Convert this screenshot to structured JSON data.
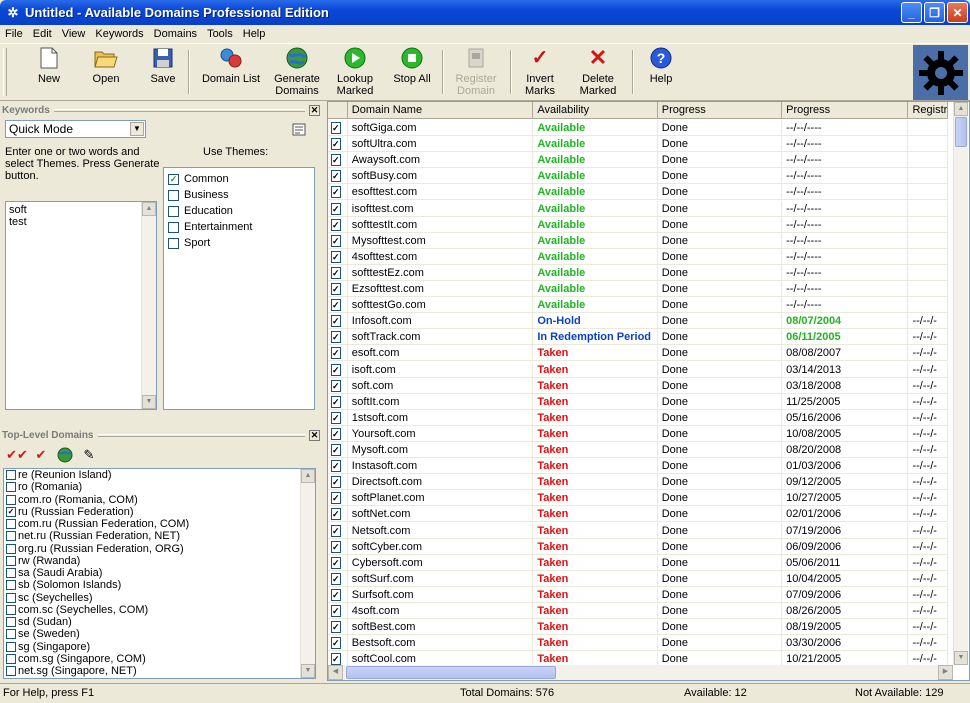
{
  "window": {
    "title": "Untitled - Available Domains Professional Edition"
  },
  "menu": [
    "File",
    "Edit",
    "View",
    "Keywords",
    "Domains",
    "Tools",
    "Help"
  ],
  "toolbar": {
    "new": "New",
    "open": "Open",
    "save": "Save",
    "domain_list": "Domain List",
    "generate_l1": "Generate",
    "generate_l2": "Domains",
    "lookup_l1": "Lookup",
    "lookup_l2": "Marked",
    "stop_all": "Stop All",
    "register_l1": "Register",
    "register_l2": "Domain",
    "invert_l1": "Invert",
    "invert_l2": "Marks",
    "delete_l1": "Delete",
    "delete_l2": "Marked",
    "help": "Help"
  },
  "keywords": {
    "title": "Keywords",
    "mode": "Quick Mode",
    "description": "Enter one or two words and select Themes. Press Generate button.",
    "use_themes": "Use Themes:",
    "words": [
      "soft",
      "test"
    ]
  },
  "themes": [
    {
      "label": "Common",
      "checked": true
    },
    {
      "label": "Business",
      "checked": false
    },
    {
      "label": "Education",
      "checked": false
    },
    {
      "label": "Entertainment",
      "checked": false
    },
    {
      "label": "Sport",
      "checked": false
    }
  ],
  "tld": {
    "title": "Top-Level Domains",
    "items": [
      {
        "label": "re (Reunion Island)",
        "checked": false
      },
      {
        "label": "ro (Romania)",
        "checked": false
      },
      {
        "label": "com.ro (Romania, COM)",
        "checked": false
      },
      {
        "label": "ru (Russian Federation)",
        "checked": true
      },
      {
        "label": "com.ru (Russian Federation, COM)",
        "checked": false
      },
      {
        "label": "net.ru (Russian Federation, NET)",
        "checked": false
      },
      {
        "label": "org.ru (Russian Federation, ORG)",
        "checked": false
      },
      {
        "label": "rw (Rwanda)",
        "checked": false
      },
      {
        "label": "sa (Saudi Arabia)",
        "checked": false
      },
      {
        "label": "sb (Solomon Islands)",
        "checked": false
      },
      {
        "label": "sc (Seychelles)",
        "checked": false
      },
      {
        "label": "com.sc (Seychelles, COM)",
        "checked": false
      },
      {
        "label": "sd (Sudan)",
        "checked": false
      },
      {
        "label": "se (Sweden)",
        "checked": false
      },
      {
        "label": "sg (Singapore)",
        "checked": false
      },
      {
        "label": "com.sg (Singapore, COM)",
        "checked": false
      },
      {
        "label": "net.sg (Singapore, NET)",
        "checked": false
      }
    ]
  },
  "grid": {
    "headers": [
      "Domain Name",
      "Availability",
      "Progress",
      "Progress",
      "Registr"
    ],
    "rows": [
      [
        "softGiga.com",
        "Available",
        "Done",
        "--/--/----",
        ""
      ],
      [
        "softUltra.com",
        "Available",
        "Done",
        "--/--/----",
        ""
      ],
      [
        "Awaysoft.com",
        "Available",
        "Done",
        "--/--/----",
        ""
      ],
      [
        "softBusy.com",
        "Available",
        "Done",
        "--/--/----",
        ""
      ],
      [
        "esofttest.com",
        "Available",
        "Done",
        "--/--/----",
        ""
      ],
      [
        "isofttest.com",
        "Available",
        "Done",
        "--/--/----",
        ""
      ],
      [
        "softtestIt.com",
        "Available",
        "Done",
        "--/--/----",
        ""
      ],
      [
        "Mysofttest.com",
        "Available",
        "Done",
        "--/--/----",
        ""
      ],
      [
        "4softtest.com",
        "Available",
        "Done",
        "--/--/----",
        ""
      ],
      [
        "softtestEz.com",
        "Available",
        "Done",
        "--/--/----",
        ""
      ],
      [
        "Ezsofttest.com",
        "Available",
        "Done",
        "--/--/----",
        ""
      ],
      [
        "softtestGo.com",
        "Available",
        "Done",
        "--/--/----",
        ""
      ],
      [
        "Infosoft.com",
        "On-Hold",
        "Done",
        "08/07/2004",
        "--/--/-"
      ],
      [
        "softTrack.com",
        "In Redemption Period",
        "Done",
        "06/11/2005",
        "--/--/-"
      ],
      [
        "esoft.com",
        "Taken",
        "Done",
        "08/08/2007",
        "--/--/-"
      ],
      [
        "isoft.com",
        "Taken",
        "Done",
        "03/14/2013",
        "--/--/-"
      ],
      [
        "soft.com",
        "Taken",
        "Done",
        "03/18/2008",
        "--/--/-"
      ],
      [
        "softIt.com",
        "Taken",
        "Done",
        "11/25/2005",
        "--/--/-"
      ],
      [
        "1stsoft.com",
        "Taken",
        "Done",
        "05/16/2006",
        "--/--/-"
      ],
      [
        "Yoursoft.com",
        "Taken",
        "Done",
        "10/08/2005",
        "--/--/-"
      ],
      [
        "Mysoft.com",
        "Taken",
        "Done",
        "08/20/2008",
        "--/--/-"
      ],
      [
        "Instasoft.com",
        "Taken",
        "Done",
        "01/03/2006",
        "--/--/-"
      ],
      [
        "Directsoft.com",
        "Taken",
        "Done",
        "09/12/2005",
        "--/--/-"
      ],
      [
        "softPlanet.com",
        "Taken",
        "Done",
        "10/27/2005",
        "--/--/-"
      ],
      [
        "softNet.com",
        "Taken",
        "Done",
        "02/01/2006",
        "--/--/-"
      ],
      [
        "Netsoft.com",
        "Taken",
        "Done",
        "07/19/2006",
        "--/--/-"
      ],
      [
        "softCyber.com",
        "Taken",
        "Done",
        "06/09/2006",
        "--/--/-"
      ],
      [
        "Cybersoft.com",
        "Taken",
        "Done",
        "05/06/2011",
        "--/--/-"
      ],
      [
        "softSurf.com",
        "Taken",
        "Done",
        "10/04/2005",
        "--/--/-"
      ],
      [
        "Surfsoft.com",
        "Taken",
        "Done",
        "07/09/2006",
        "--/--/-"
      ],
      [
        "4soft.com",
        "Taken",
        "Done",
        "08/26/2005",
        "--/--/-"
      ],
      [
        "softBest.com",
        "Taken",
        "Done",
        "08/19/2005",
        "--/--/-"
      ],
      [
        "Bestsoft.com",
        "Taken",
        "Done",
        "03/30/2006",
        "--/--/-"
      ],
      [
        "softCool.com",
        "Taken",
        "Done",
        "10/21/2005",
        "--/--/-"
      ]
    ]
  },
  "status": {
    "help": "For Help, press F1",
    "total": "Total Domains: 576",
    "available": "Available: 12",
    "not_available": "Not Available: 129"
  },
  "colors": {
    "available": "#21b521",
    "onhold": "#0a3fc8",
    "taken": "#e01010"
  }
}
